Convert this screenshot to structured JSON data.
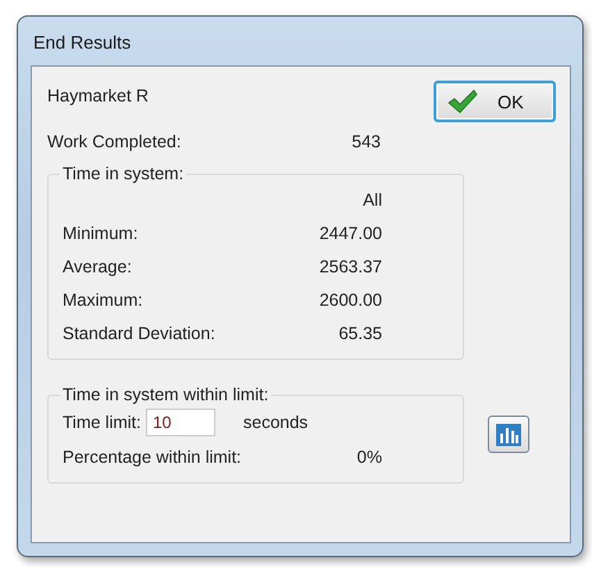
{
  "window": {
    "title": "End Results"
  },
  "name": "Haymarket R",
  "ok_button": {
    "label": "OK"
  },
  "work_completed": {
    "label": "Work Completed:",
    "value": "543"
  },
  "time_in_system": {
    "title": "Time in system:",
    "column": "All",
    "rows": [
      {
        "label": "Minimum:",
        "value": "2447.00"
      },
      {
        "label": "Average:",
        "value": "2563.37"
      },
      {
        "label": "Maximum:",
        "value": "2600.00"
      },
      {
        "label": "Standard Deviation:",
        "value": "65.35"
      }
    ]
  },
  "within_limit": {
    "title": "Time in system within limit:",
    "time_limit_label": "Time limit:",
    "time_limit_value": "10",
    "unit": "seconds",
    "percentage_label": "Percentage within limit:",
    "percentage_value": "0%"
  }
}
